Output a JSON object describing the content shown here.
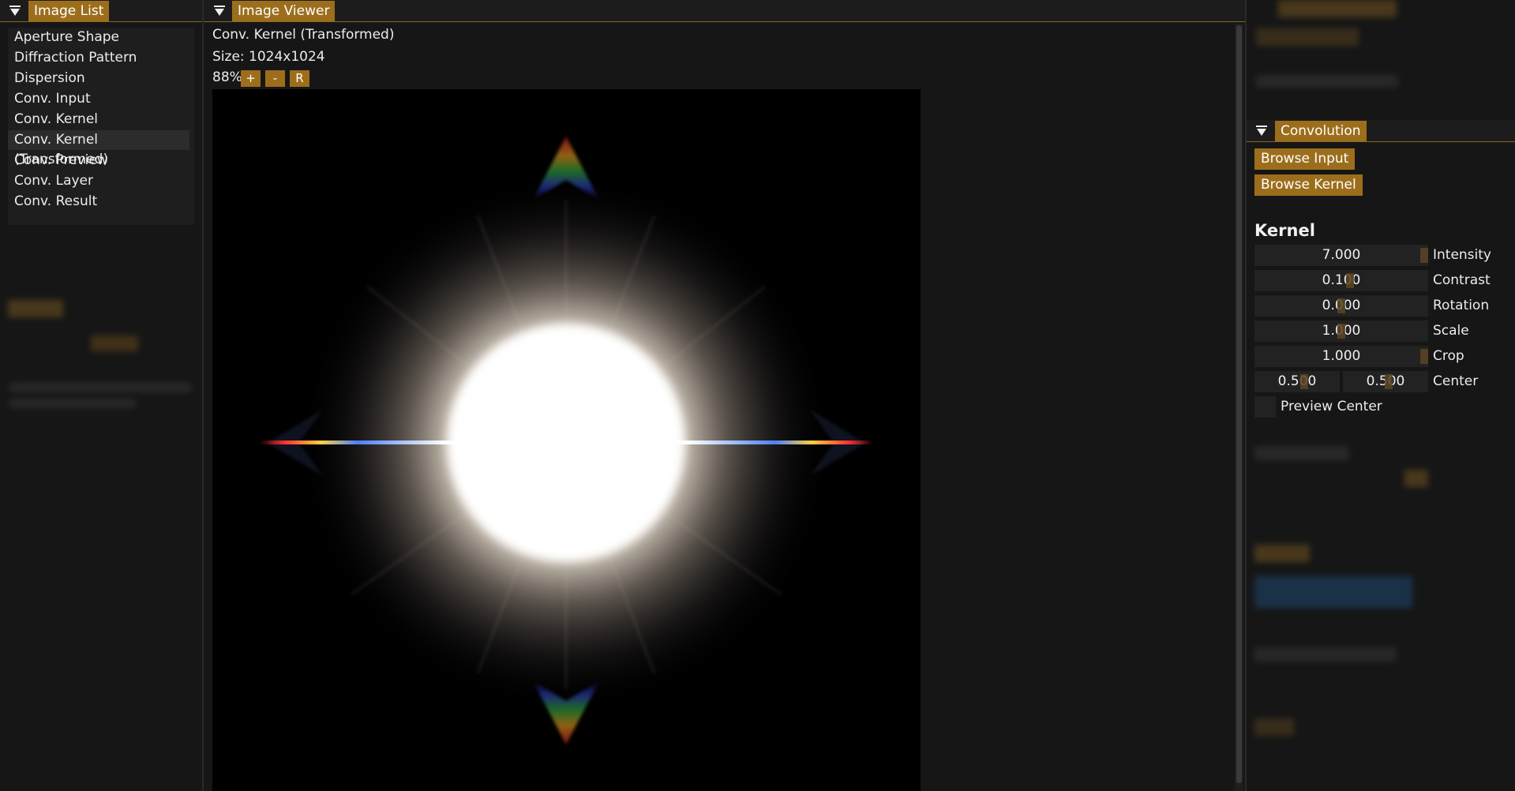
{
  "left_panel": {
    "tab_label": "Image List",
    "items": [
      {
        "label": "Aperture Shape",
        "selected": false
      },
      {
        "label": "Diffraction Pattern",
        "selected": false
      },
      {
        "label": "Dispersion",
        "selected": false
      },
      {
        "label": "Conv. Input",
        "selected": false
      },
      {
        "label": "Conv. Kernel",
        "selected": false
      },
      {
        "label": "Conv. Kernel (Transformed)",
        "selected": true
      },
      {
        "label": "Conv. Preview",
        "selected": false
      },
      {
        "label": "Conv. Layer",
        "selected": false
      },
      {
        "label": "Conv. Result",
        "selected": false
      }
    ]
  },
  "viewer": {
    "tab_label": "Image Viewer",
    "image_name": "Conv. Kernel (Transformed)",
    "size_text": "Size: 1024x1024",
    "zoom": "88%",
    "zoom_in": "+",
    "zoom_out": "-",
    "reset": "R"
  },
  "right_panel": {
    "tab_label": "Convolution",
    "browse_input": "Browse Input",
    "browse_kernel": "Browse Kernel",
    "section_title": "Kernel",
    "fields": [
      {
        "value": "7.000",
        "label": "Intensity",
        "fraction": 1.0
      },
      {
        "value": "0.100",
        "label": "Contrast",
        "fraction": 0.55
      },
      {
        "value": "0.000",
        "label": "Rotation",
        "fraction": 0.5
      },
      {
        "value": "1.000",
        "label": "Scale",
        "fraction": 0.5
      },
      {
        "value": "1.000",
        "label": "Crop",
        "fraction": 1.0
      }
    ],
    "center": {
      "x": "0.500",
      "y": "0.500",
      "label": "Center"
    },
    "preview_center_label": "Preview Center"
  },
  "colors": {
    "accent": "#9c6e1c",
    "background": "#161616",
    "field": "#222222"
  }
}
